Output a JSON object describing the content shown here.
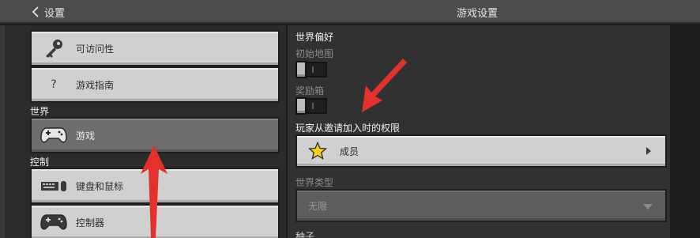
{
  "header": {
    "back_label": "设置",
    "title": "游戏设置"
  },
  "sidebar": {
    "items_top": [
      {
        "label": "可访问性",
        "icon": "key-icon"
      },
      {
        "label": "游戏指南",
        "icon": "question-icon"
      }
    ],
    "section_world": "世界",
    "world_items": [
      {
        "label": "游戏",
        "icon": "gamepad-icon",
        "selected": true
      }
    ],
    "section_controls": "控制",
    "control_items": [
      {
        "label": "键盘和鼠标",
        "icon": "keyboard-mouse-icon"
      },
      {
        "label": "控制器",
        "icon": "gamepad-icon"
      }
    ]
  },
  "main": {
    "world_prefs_heading": "世界偏好",
    "starter_map_label": "初始地图",
    "starter_map_on": false,
    "bonus_chest_label": "奖励箱",
    "bonus_chest_on": false,
    "invite_perm_heading": "玩家从邀请加入时的权限",
    "invite_perm_value": "成员",
    "world_type_label": "世界类型",
    "world_type_value": "无限",
    "seed_label": "种子"
  },
  "colors": {
    "annotation_arrow": "#e5312b",
    "button_face": "#d0d0d0",
    "selected_face": "#6d6d6d"
  }
}
